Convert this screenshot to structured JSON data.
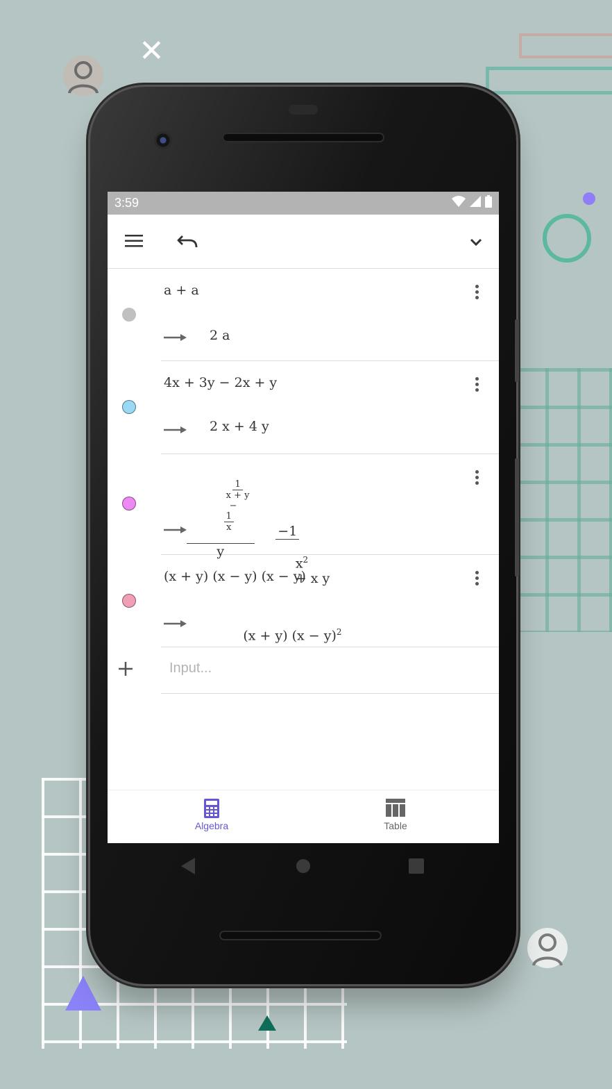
{
  "status_bar": {
    "time": "3:59"
  },
  "toolbar": {
    "menu_icon": "hamburger-menu-icon",
    "undo_icon": "undo-icon",
    "collapse_icon": "chevron-down-icon"
  },
  "algebra": {
    "rows": [
      {
        "color": "#c0c0c0",
        "input": "a + a",
        "output": "2 a"
      },
      {
        "color": "#9ad9f3",
        "input": "4x + 3y − 2x + y",
        "output": "2 x + 4 y"
      },
      {
        "color": "#ee88f2",
        "input": {
          "inner_num_1": "1",
          "inner_den_1": "x + y",
          "minus": "−",
          "inner_num_2": "1",
          "inner_den_2": "x",
          "outer_den": "y"
        },
        "output": {
          "num": "−1",
          "den_base": "x",
          "den_exp": "2",
          "den_rest": "+ x y"
        }
      },
      {
        "color": "#f19fb5",
        "input": "(x + y) (x − y) (x − y)",
        "output_base": "(x + y) (x − y)",
        "output_exp": "2"
      }
    ],
    "input_placeholder": "Input..."
  },
  "bottom_nav": {
    "tabs": [
      {
        "label": "Algebra",
        "icon": "calculator-icon",
        "active": true
      },
      {
        "label": "Table",
        "icon": "table-icon",
        "active": false
      }
    ],
    "active_color": "#6557d2",
    "inactive_color": "#666666"
  },
  "android_nav": {
    "back_icon": "back-triangle-icon",
    "home_icon": "home-circle-icon",
    "recents_icon": "recents-square-icon"
  }
}
